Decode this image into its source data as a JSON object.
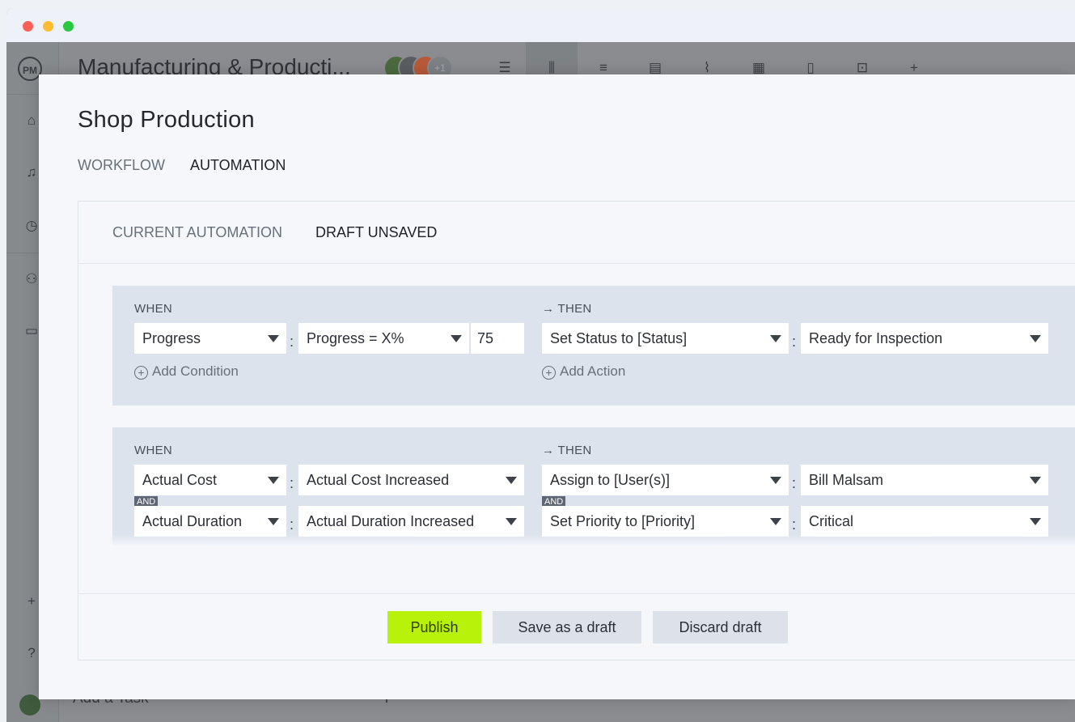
{
  "app": {
    "logo": "PM",
    "project_title": "Manufacturing & Producti...",
    "avatar_extra": "+1",
    "add_task": "Add a Task",
    "rail_icons": [
      "home-icon",
      "bell-icon",
      "clock-icon",
      "people-icon",
      "briefcase-icon",
      "plus-icon",
      "help-icon"
    ],
    "toolbar_icons": [
      "list-icon",
      "board-icon",
      "gantt-icon",
      "sheet-icon",
      "pulse-icon",
      "calendar-icon",
      "file-icon",
      "alert-icon",
      "add-view-icon"
    ]
  },
  "modal": {
    "title": "Shop Production",
    "tabs": {
      "workflow": "WORKFLOW",
      "automation": "AUTOMATION"
    },
    "subtabs": {
      "current": "CURRENT AUTOMATION",
      "draft": "DRAFT UNSAVED"
    },
    "rules": [
      {
        "when_label": "WHEN",
        "then_label": "→ THEN",
        "trigger": "Progress",
        "condition": "Progress = X%",
        "value": "75",
        "action": "Set Status to [Status]",
        "action_value": "Ready for Inspection",
        "add_condition": "Add Condition",
        "add_action": "Add Action"
      },
      {
        "when_label": "WHEN",
        "then_label": "→ THEN",
        "trigger": "Actual Cost",
        "condition": "Actual Cost Increased",
        "trigger2": "Actual Duration",
        "condition2": "Actual Duration Increased",
        "action": "Assign to [User(s)]",
        "action_value": "Bill Malsam",
        "action2": "Set Priority to [Priority]",
        "action_value2": "Critical",
        "and_label": "AND"
      }
    ],
    "buttons": {
      "publish": "Publish",
      "save_draft": "Save as a draft",
      "discard": "Discard draft"
    }
  },
  "colors": {
    "publish": "#b8f20a",
    "rule_bg": "#dde3ec",
    "modal_bg": "#f5f7fb"
  }
}
